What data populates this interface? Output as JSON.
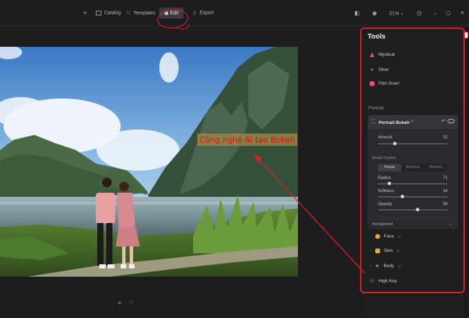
{
  "topbar": {
    "catalog_label": "Catalog",
    "templates_label": "Templates",
    "edit_label": "Edit",
    "export_label": "Export",
    "zoom_label": "21%"
  },
  "annotation": {
    "callout_text": "Công nghệ AI tạo Bokeh",
    "color": "#e01f22"
  },
  "panel": {
    "title": "Tools",
    "tools_top": [
      {
        "label": "Mystical",
        "icon": "mystical-icon",
        "color": "#e0507a"
      },
      {
        "label": "Glow",
        "icon": "glow-icon",
        "color": "#e0507a"
      },
      {
        "label": "Film Grain",
        "icon": "film-grain-icon",
        "color": "#e0507a"
      }
    ],
    "portrait_section": "Portrait",
    "portrait_bokeh": {
      "title": "Portrait Bokeh",
      "badge": "AI",
      "amount_label": "Amount",
      "amount_value": "22",
      "brush_control_label": "Brush Control",
      "brush_modes": [
        "Focus",
        "Defocus",
        "Restore"
      ],
      "active_mode": "Focus",
      "radius_label": "Radius",
      "radius_value": "71",
      "softness_label": "Softness",
      "softness_value": "34",
      "opacity_label": "Opacity",
      "opacity_value": "56",
      "background_label": "Background"
    },
    "tools_bottom": [
      {
        "label": "Face",
        "badge": "AI",
        "color": "#e8a840"
      },
      {
        "label": "Skin",
        "badge": "AI",
        "color": "#e8a840"
      },
      {
        "label": "Body",
        "badge": "AI",
        "color": "#e8a840"
      },
      {
        "label": "High Key",
        "badge": "",
        "color": "#e0507a"
      }
    ]
  }
}
